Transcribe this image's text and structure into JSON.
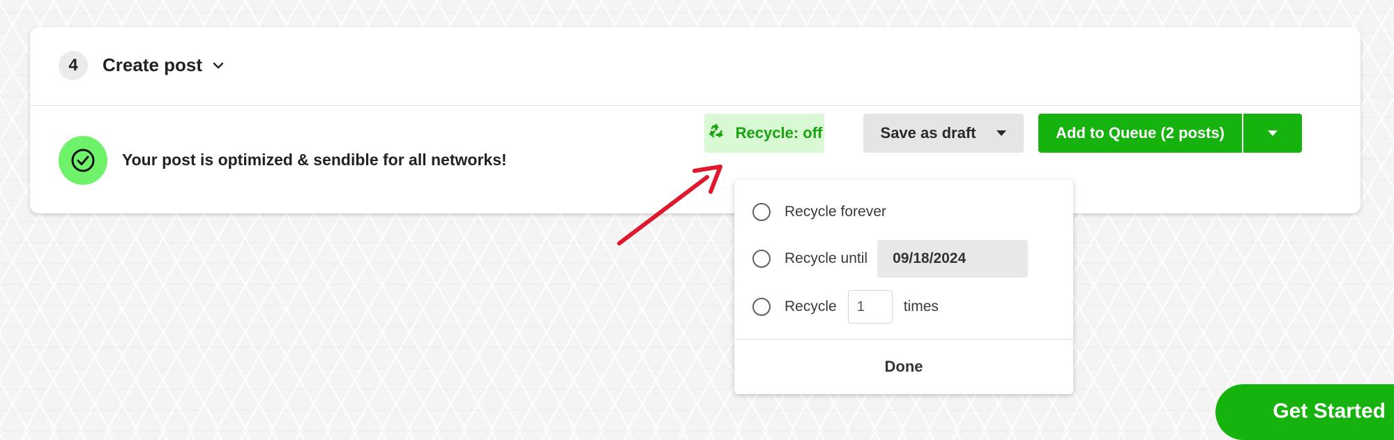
{
  "step": {
    "number": "4",
    "title": "Create post"
  },
  "status": {
    "message": "Your post is optimized & sendible for all networks!"
  },
  "actions": {
    "recycle_label": "Recycle: off",
    "draft_label": "Save as draft",
    "queue_label": "Add to Queue (2 posts)"
  },
  "recycle_menu": {
    "forever_label": "Recycle forever",
    "until_label": "Recycle until",
    "until_date": "09/18/2024",
    "times_prefix": "Recycle",
    "times_value": "1",
    "times_suffix": "times",
    "done_label": "Done"
  },
  "floating": {
    "get_started_label": "Get Started"
  },
  "colors": {
    "primary_green": "#16b20d",
    "recycle_green": "#18a30f",
    "recycle_bg": "#d9f8d4",
    "status_icon_bg": "#6ef26a",
    "annotation_red": "#e0182d"
  },
  "icons": {
    "step_chevron": "chevron-down-icon",
    "status": "check-circle-icon",
    "recycle": "recycle-icon",
    "draft_caret": "caret-down-icon",
    "queue_caret": "caret-down-icon",
    "annotation": "red-arrow-annotation"
  }
}
